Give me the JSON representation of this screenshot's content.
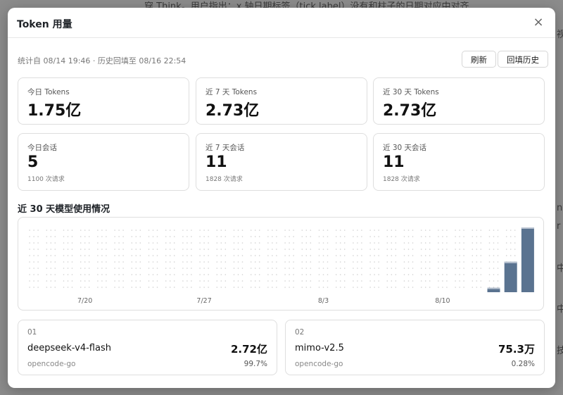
{
  "backdrop": {
    "line1": "穿 Think。用户指出：x 轴日期标签（tick label）没有和柱子的日期对应中对齐",
    "right_fragments": [
      "视",
      "n",
      "r",
      "中",
      "中",
      "技"
    ]
  },
  "modal": {
    "title": "Token 用量",
    "close_label": "×",
    "meta": "统计自 08/14 19:46 · 历史回填至 08/16 22:54",
    "refresh_label": "刷新",
    "backfill_label": "回填历史"
  },
  "stats": [
    {
      "label": "今日 Tokens",
      "value": "1.75亿",
      "sub": ""
    },
    {
      "label": "近 7 天 Tokens",
      "value": "2.73亿",
      "sub": ""
    },
    {
      "label": "近 30 天 Tokens",
      "value": "2.73亿",
      "sub": ""
    },
    {
      "label": "今日会话",
      "value": "5",
      "sub": "1100 次请求"
    },
    {
      "label": "近 7 天会话",
      "value": "11",
      "sub": "1828 次请求"
    },
    {
      "label": "近 30 天会话",
      "value": "11",
      "sub": "1828 次请求"
    }
  ],
  "chart_section": {
    "title": "近 30 天模型使用情况"
  },
  "chart_data": {
    "type": "bar",
    "x_ticks": [
      "7/20",
      "7/27",
      "8/3",
      "8/10"
    ],
    "day_count": 30,
    "values_relative": [
      0,
      0,
      0,
      0,
      0,
      0,
      0,
      0,
      0,
      0,
      0,
      0,
      0,
      0,
      0,
      0,
      0,
      0,
      0,
      0,
      0,
      0,
      0,
      0,
      0,
      0,
      0,
      0.07,
      0.47,
      1.0
    ],
    "bar_color": "#5a7390",
    "cap_color": "#b9c3d1",
    "grid": "dotted"
  },
  "models": [
    {
      "index": "01",
      "name": "deepseek-v4-flash",
      "value": "2.72亿",
      "provider": "opencode-go",
      "pct": "99.7%"
    },
    {
      "index": "02",
      "name": "mimo-v2.5",
      "value": "75.3万",
      "provider": "opencode-go",
      "pct": "0.28%"
    }
  ]
}
